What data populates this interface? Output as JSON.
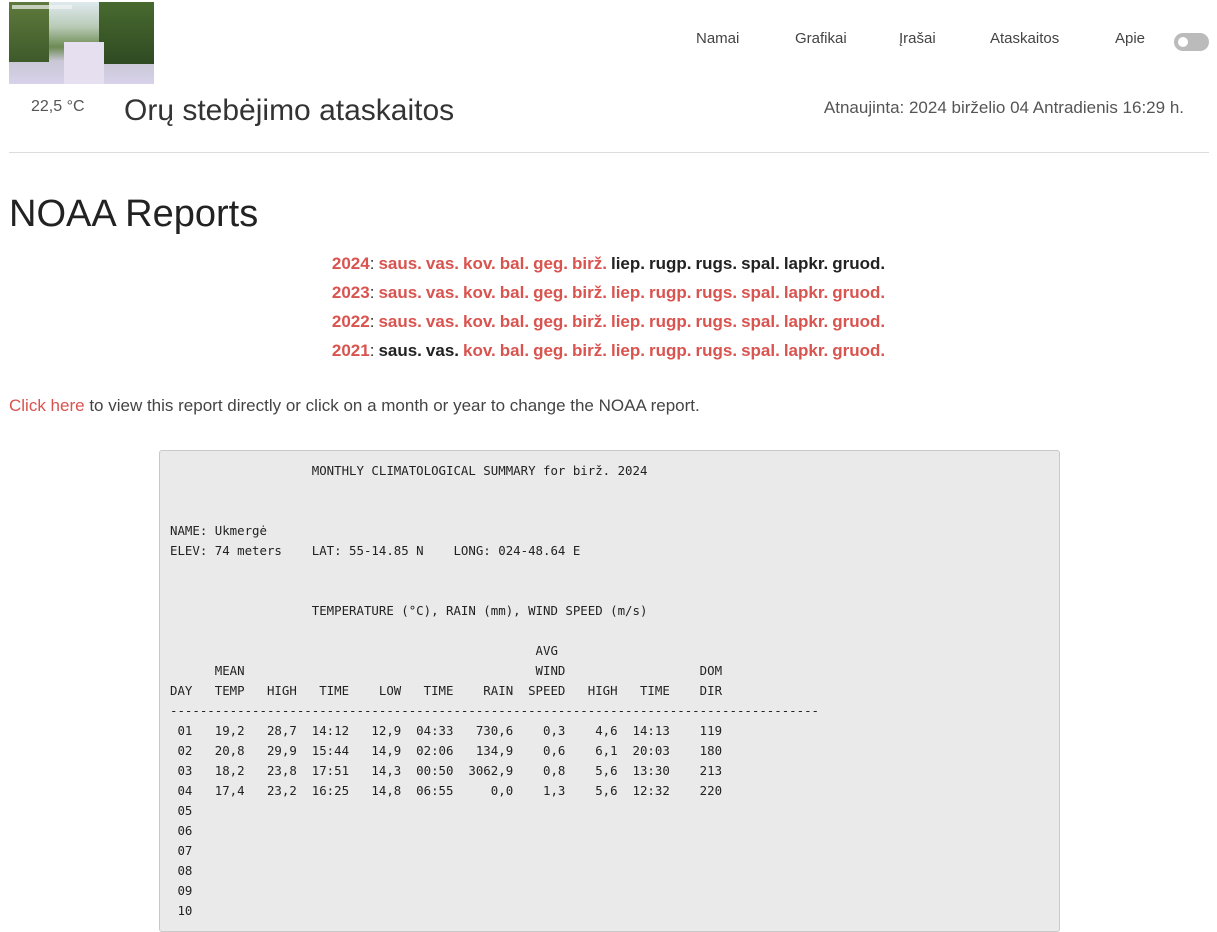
{
  "header": {
    "temperature": "22,5 °C",
    "site_title": "Orų stebėjimo ataskaitos",
    "updated": "Atnaujinta: 2024 birželio 04 Antradienis 16:29 h."
  },
  "nav": [
    "Namai",
    "Grafikai",
    "Įrašai",
    "Ataskaitos",
    "Apie"
  ],
  "page_title": "NOAA Reports",
  "years": [
    {
      "year": "2024",
      "months": [
        {
          "label": "saus.",
          "on": true
        },
        {
          "label": "vas.",
          "on": true
        },
        {
          "label": "kov.",
          "on": true
        },
        {
          "label": "bal.",
          "on": true
        },
        {
          "label": "geg.",
          "on": true
        },
        {
          "label": "birž.",
          "on": true
        },
        {
          "label": "liep.",
          "on": false
        },
        {
          "label": "rugp.",
          "on": false
        },
        {
          "label": "rugs.",
          "on": false
        },
        {
          "label": "spal.",
          "on": false
        },
        {
          "label": "lapkr.",
          "on": false
        },
        {
          "label": "gruod.",
          "on": false
        }
      ]
    },
    {
      "year": "2023",
      "months": [
        {
          "label": "saus.",
          "on": true
        },
        {
          "label": "vas.",
          "on": true
        },
        {
          "label": "kov.",
          "on": true
        },
        {
          "label": "bal.",
          "on": true
        },
        {
          "label": "geg.",
          "on": true
        },
        {
          "label": "birž.",
          "on": true
        },
        {
          "label": "liep.",
          "on": true
        },
        {
          "label": "rugp.",
          "on": true
        },
        {
          "label": "rugs.",
          "on": true
        },
        {
          "label": "spal.",
          "on": true
        },
        {
          "label": "lapkr.",
          "on": true
        },
        {
          "label": "gruod.",
          "on": true
        }
      ]
    },
    {
      "year": "2022",
      "months": [
        {
          "label": "saus.",
          "on": true
        },
        {
          "label": "vas.",
          "on": true
        },
        {
          "label": "kov.",
          "on": true
        },
        {
          "label": "bal.",
          "on": true
        },
        {
          "label": "geg.",
          "on": true
        },
        {
          "label": "birž.",
          "on": true
        },
        {
          "label": "liep.",
          "on": true
        },
        {
          "label": "rugp.",
          "on": true
        },
        {
          "label": "rugs.",
          "on": true
        },
        {
          "label": "spal.",
          "on": true
        },
        {
          "label": "lapkr.",
          "on": true
        },
        {
          "label": "gruod.",
          "on": true
        }
      ]
    },
    {
      "year": "2021",
      "months": [
        {
          "label": "saus.",
          "on": false
        },
        {
          "label": "vas.",
          "on": false
        },
        {
          "label": "kov.",
          "on": true
        },
        {
          "label": "bal.",
          "on": true
        },
        {
          "label": "geg.",
          "on": true
        },
        {
          "label": "birž.",
          "on": true
        },
        {
          "label": "liep.",
          "on": true
        },
        {
          "label": "rugp.",
          "on": true
        },
        {
          "label": "rugs.",
          "on": true
        },
        {
          "label": "spal.",
          "on": true
        },
        {
          "label": "lapkr.",
          "on": true
        },
        {
          "label": "gruod.",
          "on": true
        }
      ]
    }
  ],
  "intro": {
    "link_text": "Click here",
    "rest_text": " to view this report directly or click on a month or year to change the NOAA report."
  },
  "report": {
    "text": "                   MONTHLY CLIMATOLOGICAL SUMMARY for birž. 2024\n\n\nNAME: Ukmergė\nELEV: 74 meters    LAT: 55-14.85 N    LONG: 024-48.64 E\n\n\n                   TEMPERATURE (°C), RAIN (mm), WIND SPEED (m/s)\n\n                                                 AVG\n      MEAN                                       WIND                  DOM\nDAY   TEMP   HIGH   TIME    LOW   TIME    RAIN  SPEED   HIGH   TIME    DIR\n---------------------------------------------------------------------------------------\n 01   19,2   28,7  14:12   12,9  04:33   730,6    0,3    4,6  14:13    119\n 02   20,8   29,9  15:44   14,9  02:06   134,9    0,6    6,1  20:03    180\n 03   18,2   23,8  17:51   14,3  00:50  3062,9    0,8    5,6  13:30    213\n 04   17,4   23,2  16:25   14,8  06:55     0,0    1,3    5,6  12:32    220\n 05\n 06\n 07\n 08\n 09\n 10"
  },
  "colors": {
    "accent": "#d9534f",
    "report_bg": "#eaeaea"
  }
}
